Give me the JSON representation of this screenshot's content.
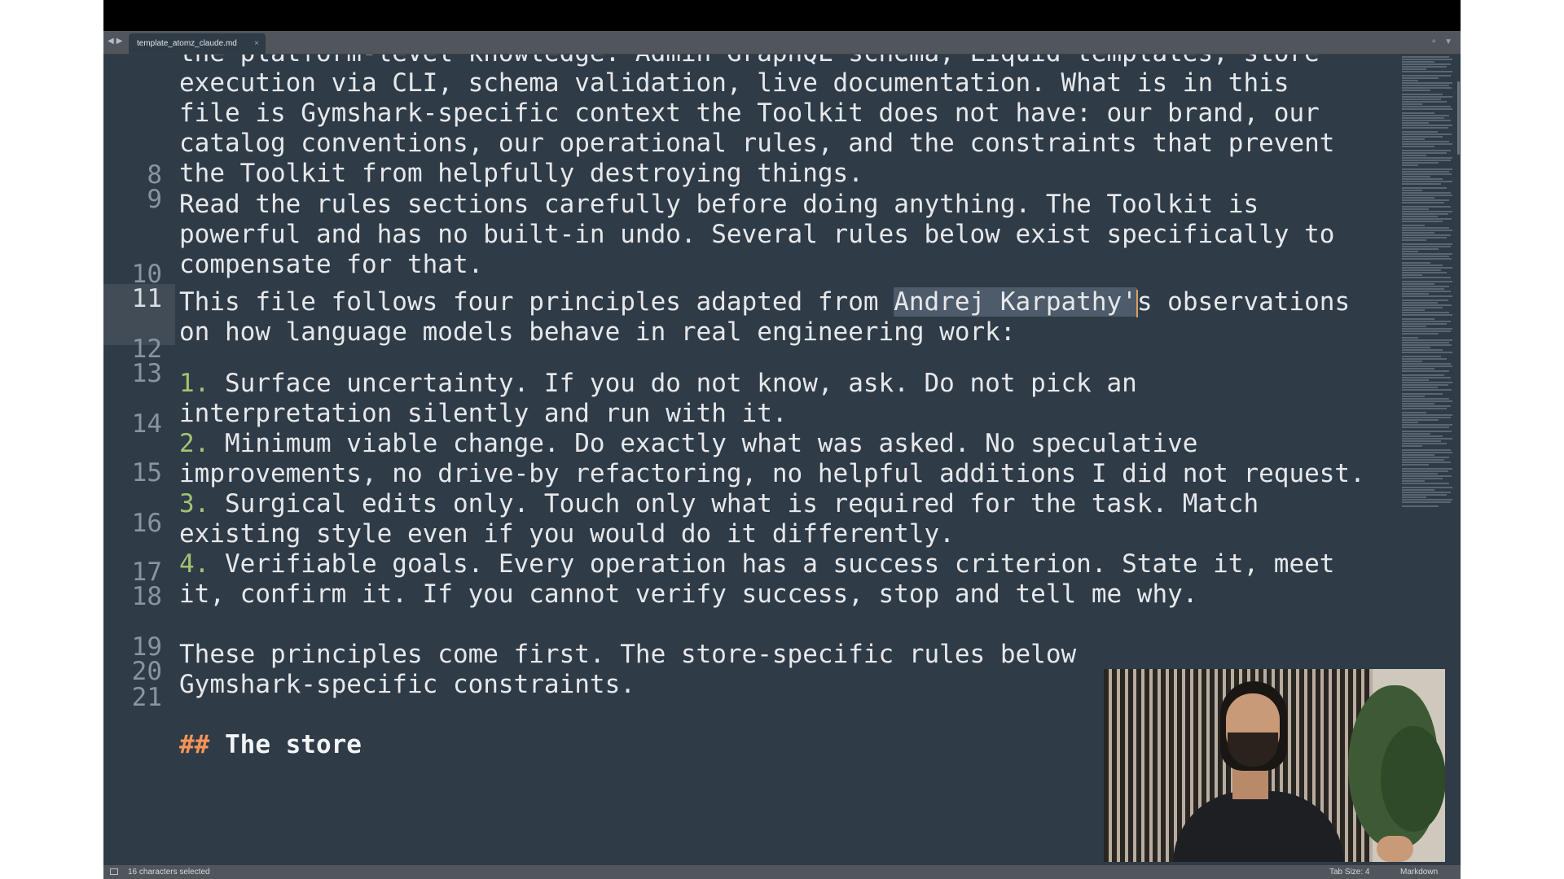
{
  "tab": {
    "title": "template_atomz_claude.md",
    "close_glyph": "×"
  },
  "nav": {
    "back": "◀",
    "forward": "▶"
  },
  "tabbar_right": {
    "new_tab": "+",
    "menu": "▼"
  },
  "gutter": {
    "line_8": "8",
    "line_9": "9",
    "line_10": "10",
    "line_11": "11",
    "line_12": "12",
    "line_13": "13",
    "line_14": "14",
    "line_15": "15",
    "line_16": "16",
    "line_17": "17",
    "line_18": "18",
    "line_19": "19",
    "line_20": "20",
    "line_21": "21"
  },
  "document": {
    "row_a": "the platform-level knowledge: Admin GraphQL schema, Liquid templates, store",
    "row_b": "execution via CLI, schema validation, live documentation. What is in this",
    "row_c": "file is Gymshark-specific context the Toolkit does not have: our brand, our",
    "row_d": "catalog conventions, our operational rules, and the constraints that prevent",
    "row_e": "the Toolkit from helpfully destroying things.",
    "l9_a": "Read the rules sections carefully before doing anything. The Toolkit is",
    "l9_b": "powerful and has no built-in undo. Several rules below exist specifically to",
    "l9_c": "compensate for that.",
    "l11_a_pre": "This file follows four principles adapted from ",
    "l11_a_sel": "Andrej Karpathy'",
    "l11_a_post": "s observations",
    "l11_b": "on how language models behave in real engineering work:",
    "l13_num": "1.",
    "l13_a": " Surface uncertainty. If you do not know, ask. Do not pick an",
    "l13_b": "interpretation silently and run with it.",
    "l14_num": "2.",
    "l14_a": " Minimum viable change. Do exactly what was asked. No speculative",
    "l14_b": "improvements, no drive-by refactoring, no helpful additions I did not request.",
    "l15_num": "3.",
    "l15_a": " Surgical edits only. Touch only what is required for the task. Match",
    "l15_b": "existing style even if you would do it differently.",
    "l16_num": "4.",
    "l16_a": " Verifiable goals. Every operation has a success criterion. State it, meet",
    "l16_b": "it, confirm it. If you cannot verify success, stop and tell me why.",
    "l18_a": "These principles come first. The store-specific rules below",
    "l18_b": "Gymshark-specific constraints.",
    "l20_hash": "##",
    "l20_title": " The store"
  },
  "status": {
    "selection": "16 characters selected",
    "tab_size": "Tab Size: 4",
    "syntax": "Markdown"
  },
  "colors": {
    "editor_bg": "#2f3b47",
    "text": "#e6e8eb",
    "list_number": "#a3c274",
    "heading_hash": "#f39357",
    "selection": "#4d5b6a",
    "caret": "#d9a25e"
  },
  "icons": {
    "nav_back": "triangle-left-icon",
    "nav_forward": "triangle-right-icon",
    "tab_close": "close-icon",
    "new_tab": "plus-icon",
    "tab_menu": "chevron-down-icon",
    "panel_toggle": "sidebar-toggle-icon"
  }
}
